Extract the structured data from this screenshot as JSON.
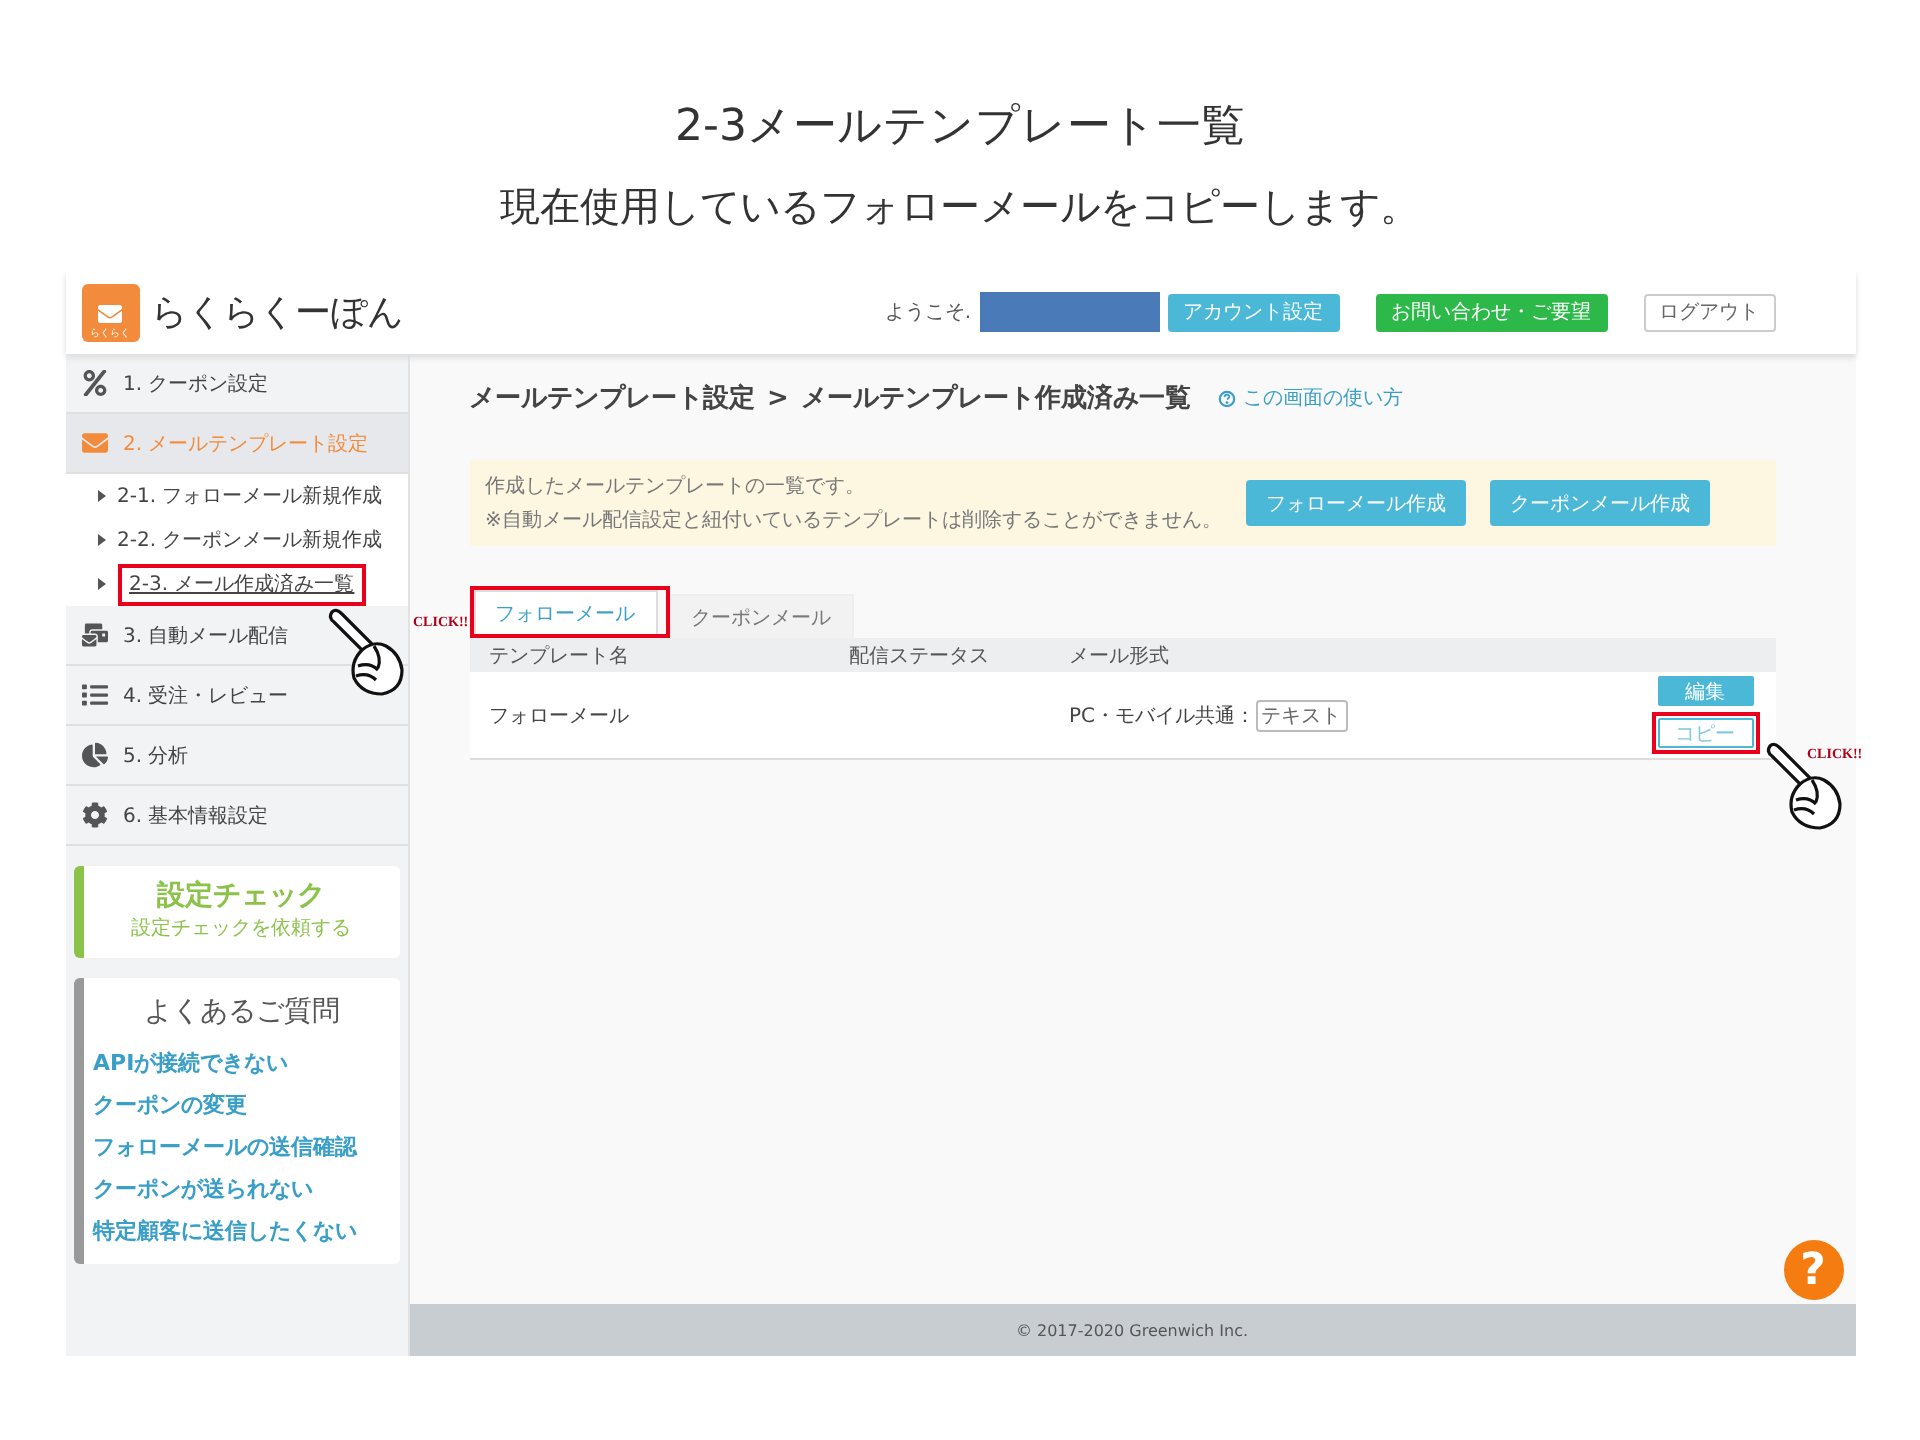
{
  "slide": {
    "title": "2-3メールテンプレート一覧",
    "subtitle": "現在使用しているフォローメールをコピーします。"
  },
  "header": {
    "logo_text": "らくらくーぽん",
    "logo_badge": "らくらく",
    "welcome": "ようこそ.",
    "name_redacted": true,
    "buttons": [
      {
        "label": "アカウント設定",
        "kind": "info"
      },
      {
        "label": "お問い合わせ・ご要望",
        "kind": "success"
      },
      {
        "label": "ログアウト",
        "kind": "plain"
      }
    ]
  },
  "sidebar": {
    "nav": [
      {
        "label": "1. クーポン設定",
        "selected": false
      },
      {
        "label": "2. メールテンプレート設定",
        "selected": true,
        "children": [
          {
            "label": "2-1. フォローメール新規作成",
            "selected": false,
            "highlighted": false
          },
          {
            "label": "2-2. クーポンメール新規作成",
            "selected": false,
            "highlighted": false
          },
          {
            "label": "2-3. メール作成済み一覧",
            "selected": true,
            "highlighted": true,
            "callout": "CLICK!!"
          }
        ]
      },
      {
        "label": "3. 自動メール配信",
        "selected": false
      },
      {
        "label": "4. 受注・レビュー",
        "selected": false
      },
      {
        "label": "5. 分析",
        "selected": false
      },
      {
        "label": "6. 基本情報設定",
        "selected": false
      }
    ],
    "check_card": {
      "title": "設定チェック",
      "subtitle": "設定チェックを依頼する"
    },
    "faq": {
      "title": "よくあるご質問",
      "links": [
        "APIが接続できない",
        "クーポンの変更",
        "フォローメールの送信確認",
        "クーポンが送られない",
        "特定顧客に送信したくない"
      ]
    }
  },
  "main": {
    "breadcrumb": [
      "メールテンプレート設定",
      "メールテンプレート作成済み一覧"
    ],
    "separator": ">",
    "help_link": "この画面の使い方",
    "notice": {
      "lines": [
        "作成したメールテンプレートの一覧です。",
        "※自動メール配信設定と紐付いているテンプレートは削除することができません。"
      ],
      "buttons": [
        "フォローメール作成",
        "クーポンメール作成"
      ]
    },
    "tabs": [
      {
        "label": "フォローメール",
        "selected": true,
        "highlighted": true
      },
      {
        "label": "クーポンメール",
        "selected": false,
        "highlighted": false
      }
    ],
    "table": {
      "columns": [
        "テンプレート名",
        "配信ステータス",
        "メール形式"
      ],
      "rows": [
        {
          "name": "フォローメール",
          "format_label": "PC・モバイル共通：",
          "format_badge": "テキスト",
          "actions": [
            {
              "label": "編集",
              "kind": "primary"
            },
            {
              "label": "コピー",
              "kind": "outline",
              "highlighted": true,
              "callout": "CLICK!!"
            }
          ]
        }
      ]
    }
  },
  "footer": "© 2017-2020 Greenwich Inc.",
  "help_button": "?"
}
